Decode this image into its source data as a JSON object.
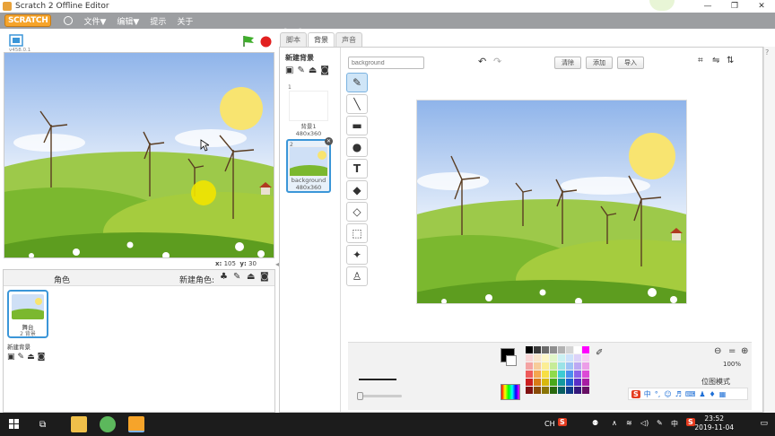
{
  "window": {
    "title": "Scratch 2 Offline Editor",
    "minimize": "—",
    "maximize": "❐",
    "close": "✕"
  },
  "menubar": {
    "logo": "SCRATCH",
    "items": [
      "文件▼",
      "编辑▼",
      "提示",
      "关于"
    ]
  },
  "stage": {
    "version": "v458.0.1",
    "x_label": "x:",
    "x_value": "105",
    "y_label": "y:",
    "y_value": "30"
  },
  "sprite_pane": {
    "header": "角色",
    "new_sprite_label": "新建角色:",
    "stage_thumb_name": "舞台",
    "stage_thumb_sub": "2 背景",
    "new_backdrop_label": "新建背景"
  },
  "tabs": [
    {
      "label": "脚本",
      "active": false
    },
    {
      "label": "背景",
      "active": true
    },
    {
      "label": "声音",
      "active": false
    }
  ],
  "backdrop_list": {
    "new_backdrop_label": "新建背景",
    "items": [
      {
        "num": "1",
        "name": "背景1",
        "size": "480x360"
      },
      {
        "num": "2",
        "name": "background",
        "size": "480x360"
      }
    ]
  },
  "editor": {
    "name_placeholder": "background",
    "buttons": {
      "clear": "清除",
      "add": "添加",
      "import": "导入"
    },
    "zoom": "100%",
    "mode": "位图模式"
  },
  "tools": [
    "brush",
    "line",
    "rectangle",
    "ellipse",
    "text",
    "fill",
    "eraser",
    "select",
    "select-remove",
    "stamp"
  ],
  "palette": [
    "#000000",
    "#3a3a3a",
    "#6b6b6b",
    "#8f8f8f",
    "#b2b2b2",
    "#d4d4d4",
    "#ffffff",
    "#ff00ff",
    "#f9d6d6",
    "#f9e6cc",
    "#fdf7c8",
    "#e2f7c9",
    "#cbf1f3",
    "#cde2fb",
    "#dcd2f9",
    "#f6d0f4",
    "#f4a3a3",
    "#f7cc9a",
    "#fbed94",
    "#c6ec98",
    "#9be3e7",
    "#9ec3f5",
    "#bca8f3",
    "#ec9ee8",
    "#ee5a5a",
    "#f4a64f",
    "#f7df44",
    "#8fdb4b",
    "#3dcbd3",
    "#4a8fee",
    "#8a63ea",
    "#dc4ad6",
    "#cc1f1f",
    "#d97a15",
    "#d8b80b",
    "#4aa91b",
    "#13999f",
    "#1c5fcf",
    "#5a2fc7",
    "#a71da2",
    "#7f1111",
    "#8a4b08",
    "#8a7506",
    "#2b6a0f",
    "#0a5f63",
    "#0f3a86",
    "#35197c",
    "#670f64"
  ],
  "taskbar": {
    "time": "23:52",
    "date": "2019-11-04",
    "tray_items": [
      "CH",
      "中"
    ]
  }
}
